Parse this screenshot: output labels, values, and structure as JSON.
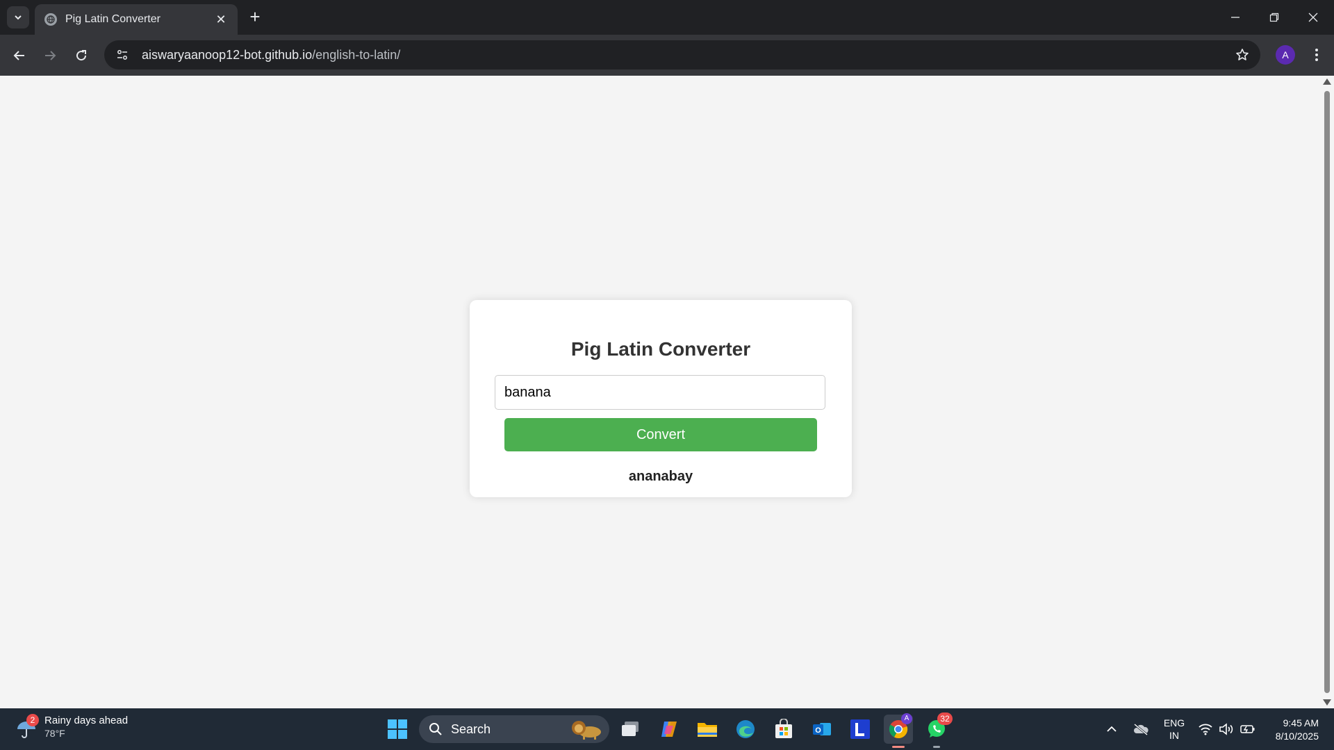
{
  "browser": {
    "tab_title": "Pig Latin Converter",
    "url_host": "aiswaryaanoop12-bot.github.io",
    "url_path": "/english-to-latin/",
    "profile_initial": "A"
  },
  "page": {
    "heading": "Pig Latin Converter",
    "input_value": "banana",
    "convert_label": "Convert",
    "result": "ananabay",
    "colors": {
      "button": "#4caf50",
      "background": "#f4f4f4"
    }
  },
  "taskbar": {
    "weather_title": "Rainy days ahead",
    "weather_temp": "78°F",
    "weather_badge": "2",
    "search_label": "Search",
    "whatsapp_badge": "32",
    "lang_line1": "ENG",
    "lang_line2": "IN",
    "time": "9:45 AM",
    "date": "8/10/2025",
    "icons": [
      "task-view-icon",
      "copilot-icon",
      "file-explorer-icon",
      "edge-icon",
      "microsoft-store-icon",
      "outlook-icon",
      "l-app-icon",
      "chrome-icon",
      "whatsapp-icon"
    ]
  }
}
